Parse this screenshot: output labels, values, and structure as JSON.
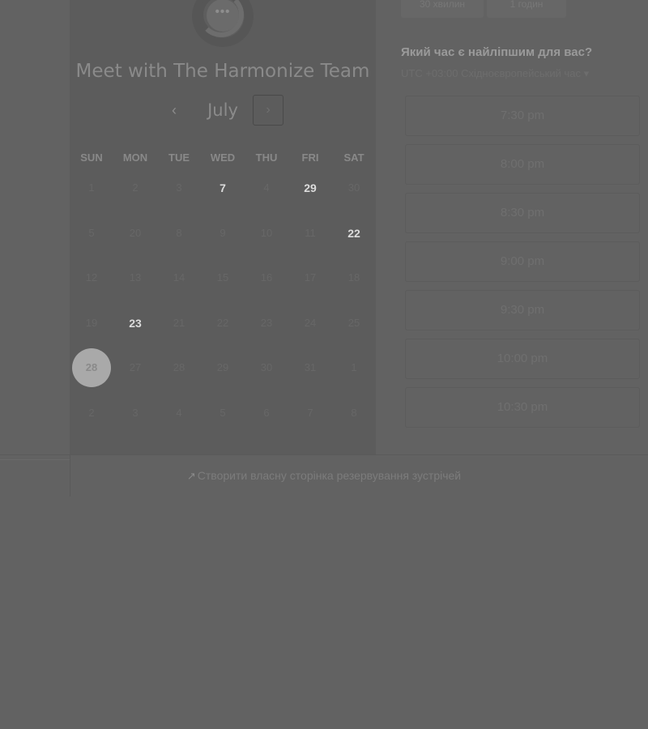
{
  "calendar": {
    "title": "Meet with The Harmonize Team",
    "month": "July",
    "prev_icon": "‹",
    "next_icon": "›",
    "weekdays": [
      "SUN",
      "MON",
      "TUE",
      "WED",
      "THU",
      "FRI",
      "SAT"
    ],
    "weeks": [
      [
        "1",
        "2",
        "3",
        "7",
        "4",
        "29",
        "30"
      ],
      [
        "5",
        "20",
        "8",
        "9",
        "10",
        "11",
        "22"
      ],
      [
        "12",
        "13",
        "14",
        "15",
        "16",
        "17",
        "18"
      ],
      [
        "19",
        "23",
        "21",
        "22",
        "23",
        "24",
        "25"
      ],
      [
        "28",
        "27",
        "28",
        "29",
        "30",
        "31",
        "1"
      ],
      [
        "2",
        "3",
        "4",
        "5",
        "6",
        "7",
        "8"
      ]
    ],
    "available_days": [
      "7",
      "29",
      "22",
      "23"
    ],
    "selected_day": "28"
  },
  "durations": [
    "30 хвилин",
    "1 годин"
  ],
  "right": {
    "title": "Який час є найліпшим для вас?",
    "timezone": "UTC +03:00 Східноєвропейський час",
    "timezone_caret": "▾",
    "slots": [
      "7:30 pm",
      "8:00 pm",
      "8:30 pm",
      "9:00 pm",
      "9:30 pm",
      "10:00 pm",
      "10:30 pm"
    ]
  },
  "footer": {
    "link_icon": "↗",
    "link_text": "Створити власну сторінка резервування зустрічей"
  }
}
